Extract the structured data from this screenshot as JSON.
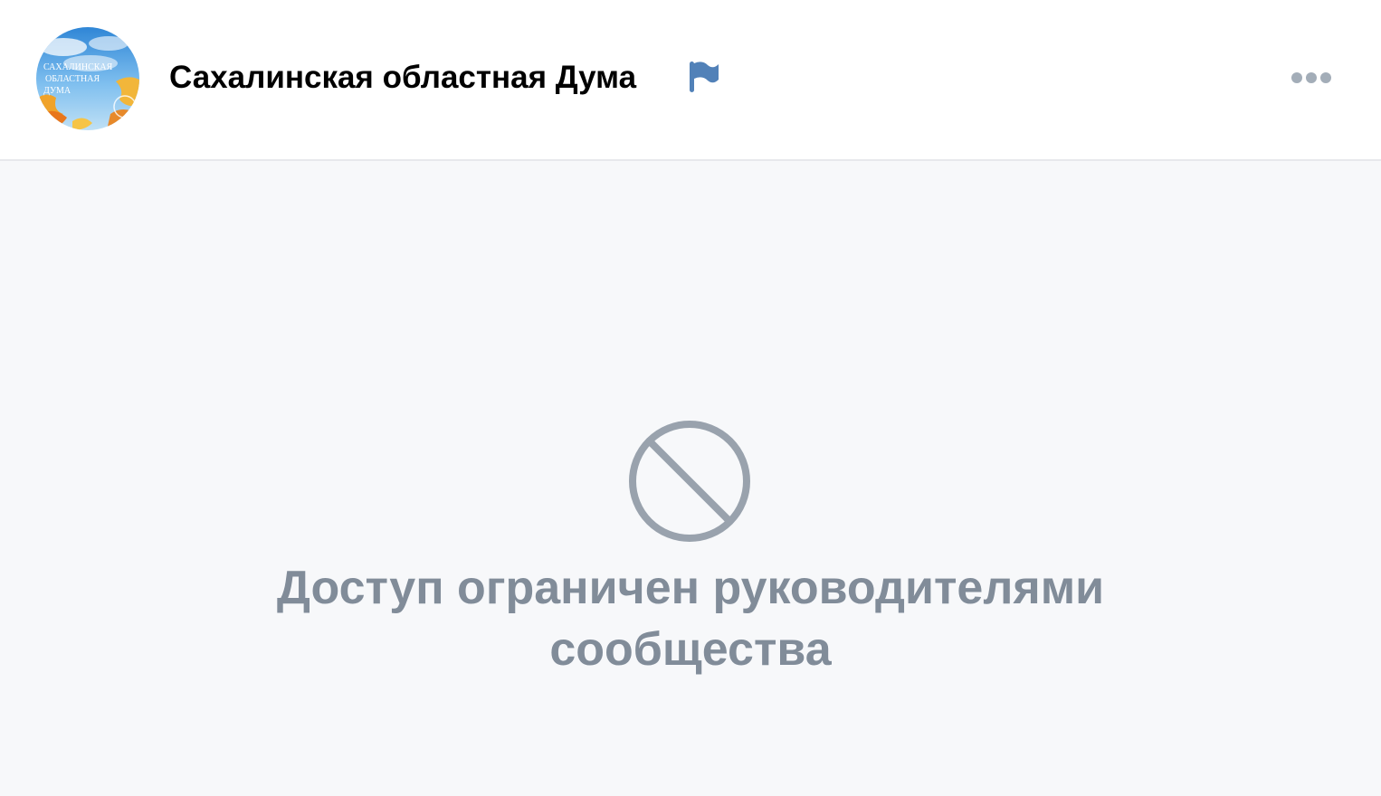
{
  "header": {
    "group_name": "Сахалинская областная Дума",
    "avatar": {
      "alt_icon": "group-avatar",
      "logo_lines": [
        "САХАЛИНСКАЯ",
        "ОБЛАСТНАЯ",
        "ДУМА"
      ]
    },
    "flag_icon": "flag-icon",
    "more_icon": "more-horizontal-icon"
  },
  "content": {
    "blocked_icon": "blocked-icon",
    "message": "Доступ ограничен руководителями сообщества"
  },
  "colors": {
    "header_bg": "#ffffff",
    "page_bg": "#f7f8fa",
    "accent_flag": "#5181b8",
    "muted_text": "#818c99",
    "icon_gray": "#99a2ad",
    "divider": "#e7e8ec"
  }
}
